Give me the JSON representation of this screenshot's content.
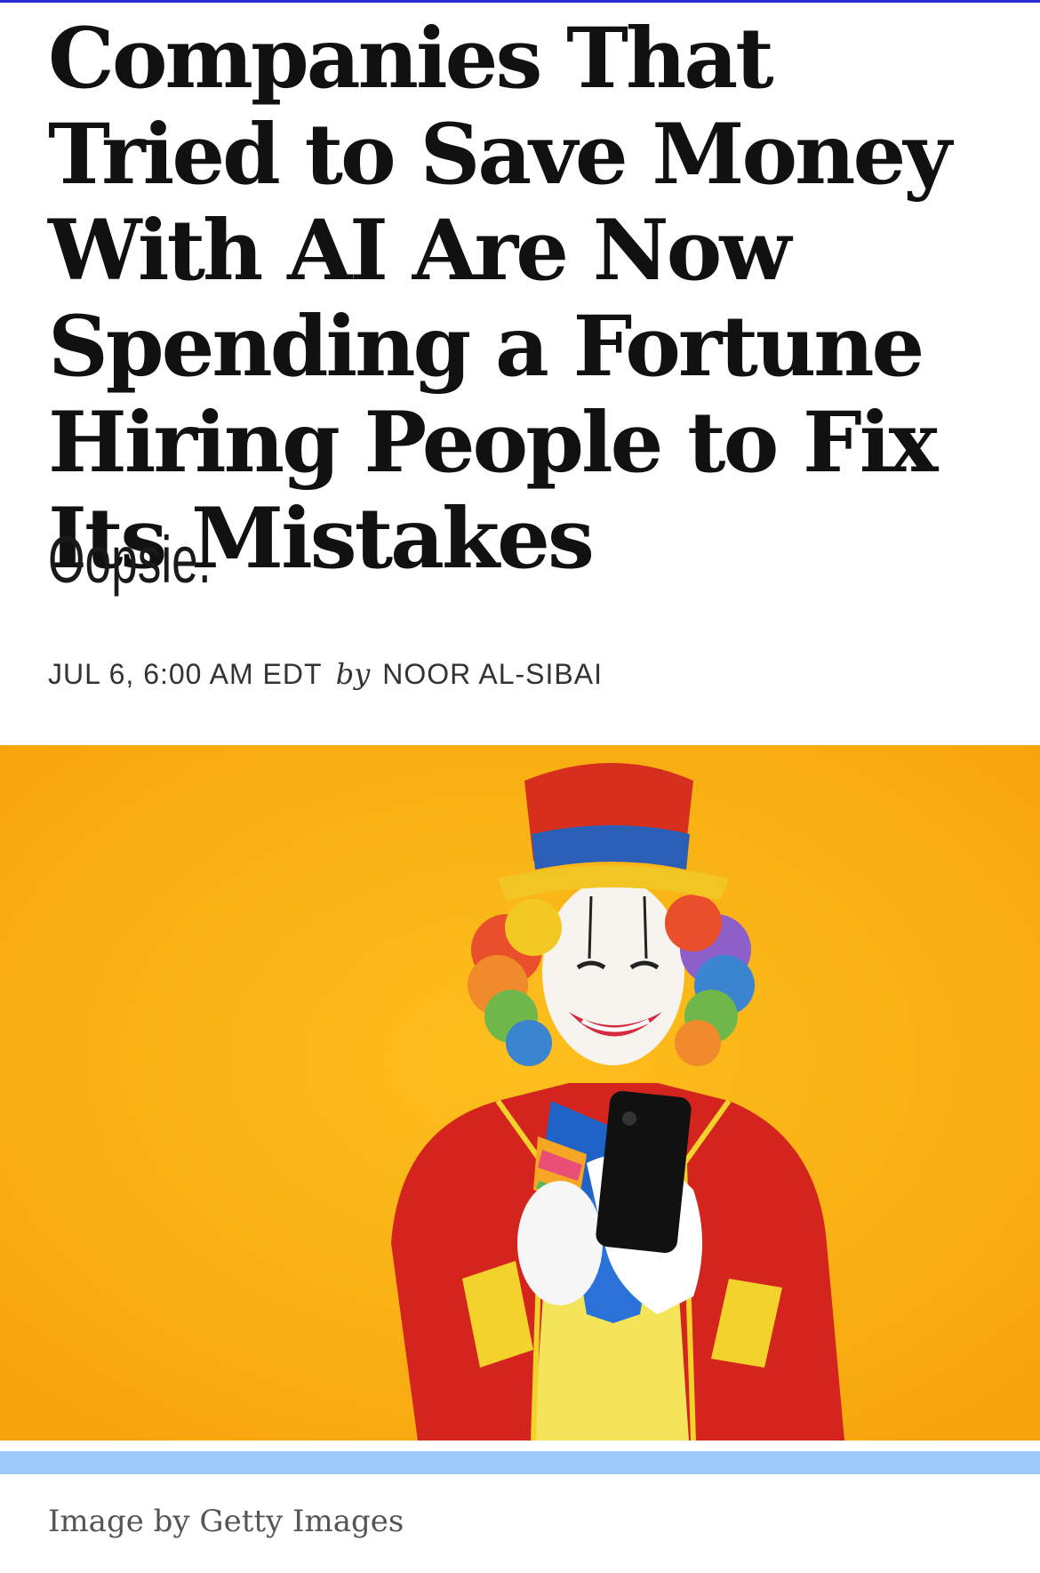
{
  "article": {
    "headline": "Companies That Tried to Save Money With AI Are Now Spending a Fortune Hiring People to Fix Its Mistakes",
    "dek": "Oopsie.",
    "date": "JUL 6, 6:00 AM EDT",
    "by_word": "by",
    "author": "NOOR AL-SIBAI",
    "image_caption": "Image by Getty Images"
  },
  "colors": {
    "accent_rule": "#2a2ad6",
    "image_background": "#fbb514",
    "scrollbar": "#9cc8fa"
  },
  "icons": {
    "hero_image": "clown-with-phone-illustration"
  }
}
